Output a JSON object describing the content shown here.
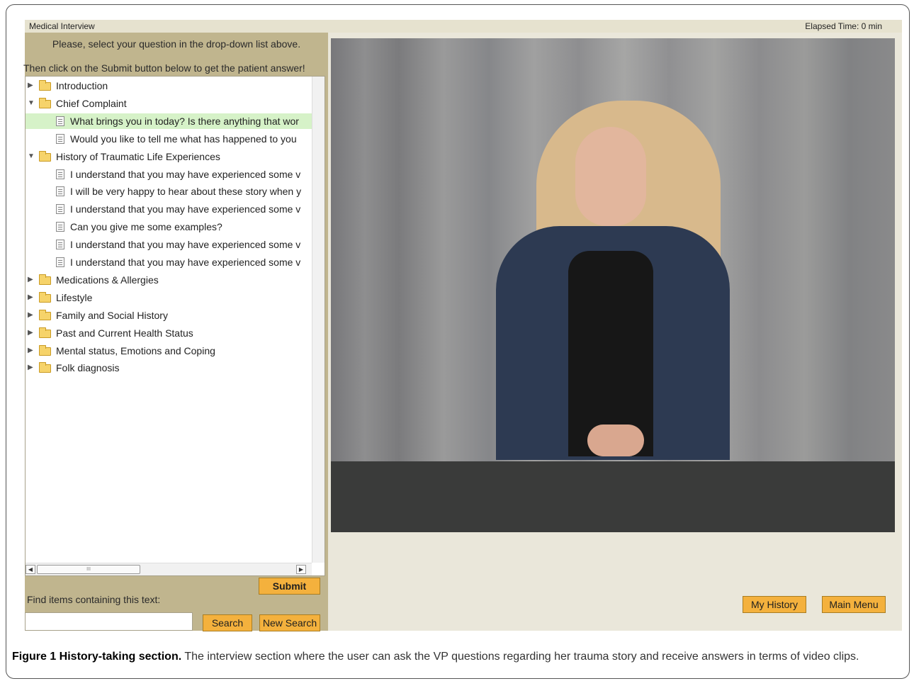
{
  "app": {
    "title": "Medical Interview",
    "elapsed_time": "Elapsed Time:  0 min"
  },
  "instructions": {
    "line1": "Please, select your question in the drop-down list above.",
    "line2": "Then click on the Submit button below to get the patient answer!"
  },
  "tree": {
    "items": [
      {
        "type": "category",
        "expanded": false,
        "label": "Introduction"
      },
      {
        "type": "category",
        "expanded": true,
        "label": "Chief Complaint"
      },
      {
        "type": "question",
        "selected": true,
        "label": "What brings you in today? Is there anything that wor"
      },
      {
        "type": "question",
        "selected": false,
        "label": "Would you like to tell me what has happened to you"
      },
      {
        "type": "category",
        "expanded": true,
        "label": "History of Traumatic Life Experiences"
      },
      {
        "type": "question",
        "selected": false,
        "label": "I understand that you may have experienced some v"
      },
      {
        "type": "question",
        "selected": false,
        "label": "I will be very happy to hear about these story when y"
      },
      {
        "type": "question",
        "selected": false,
        "label": "I understand that you may have experienced some v"
      },
      {
        "type": "question",
        "selected": false,
        "label": "Can you give me some examples?"
      },
      {
        "type": "question",
        "selected": false,
        "label": "I understand that you may have experienced some v"
      },
      {
        "type": "question",
        "selected": false,
        "label": "I understand that you may have experienced some v"
      },
      {
        "type": "category",
        "expanded": false,
        "label": "Medications & Allergies"
      },
      {
        "type": "category",
        "expanded": false,
        "label": "Lifestyle"
      },
      {
        "type": "category",
        "expanded": false,
        "label": "Family and Social History"
      },
      {
        "type": "category",
        "expanded": false,
        "label": "Past and Current Health Status"
      },
      {
        "type": "category",
        "expanded": false,
        "label": "Mental status, Emotions and Coping"
      },
      {
        "type": "category",
        "expanded": false,
        "label": "Folk diagnosis"
      }
    ],
    "scroll_thumb_glyph": "III"
  },
  "controls": {
    "submit_label": "Submit",
    "find_label": "Find items containing this text:",
    "search_value": "",
    "search_label": "Search",
    "new_search_label": "New Search",
    "my_history_label": "My History",
    "main_menu_label": "Main Menu"
  },
  "caption": {
    "bold": "Figure 1 History-taking section.",
    "text": " The interview section where the user can ask the VP questions regarding her trauma story and receive answers in terms of video clips."
  },
  "colors": {
    "panel": "#c0b58e",
    "button": "#f4b13d",
    "selected_row": "#d6f2c8"
  }
}
